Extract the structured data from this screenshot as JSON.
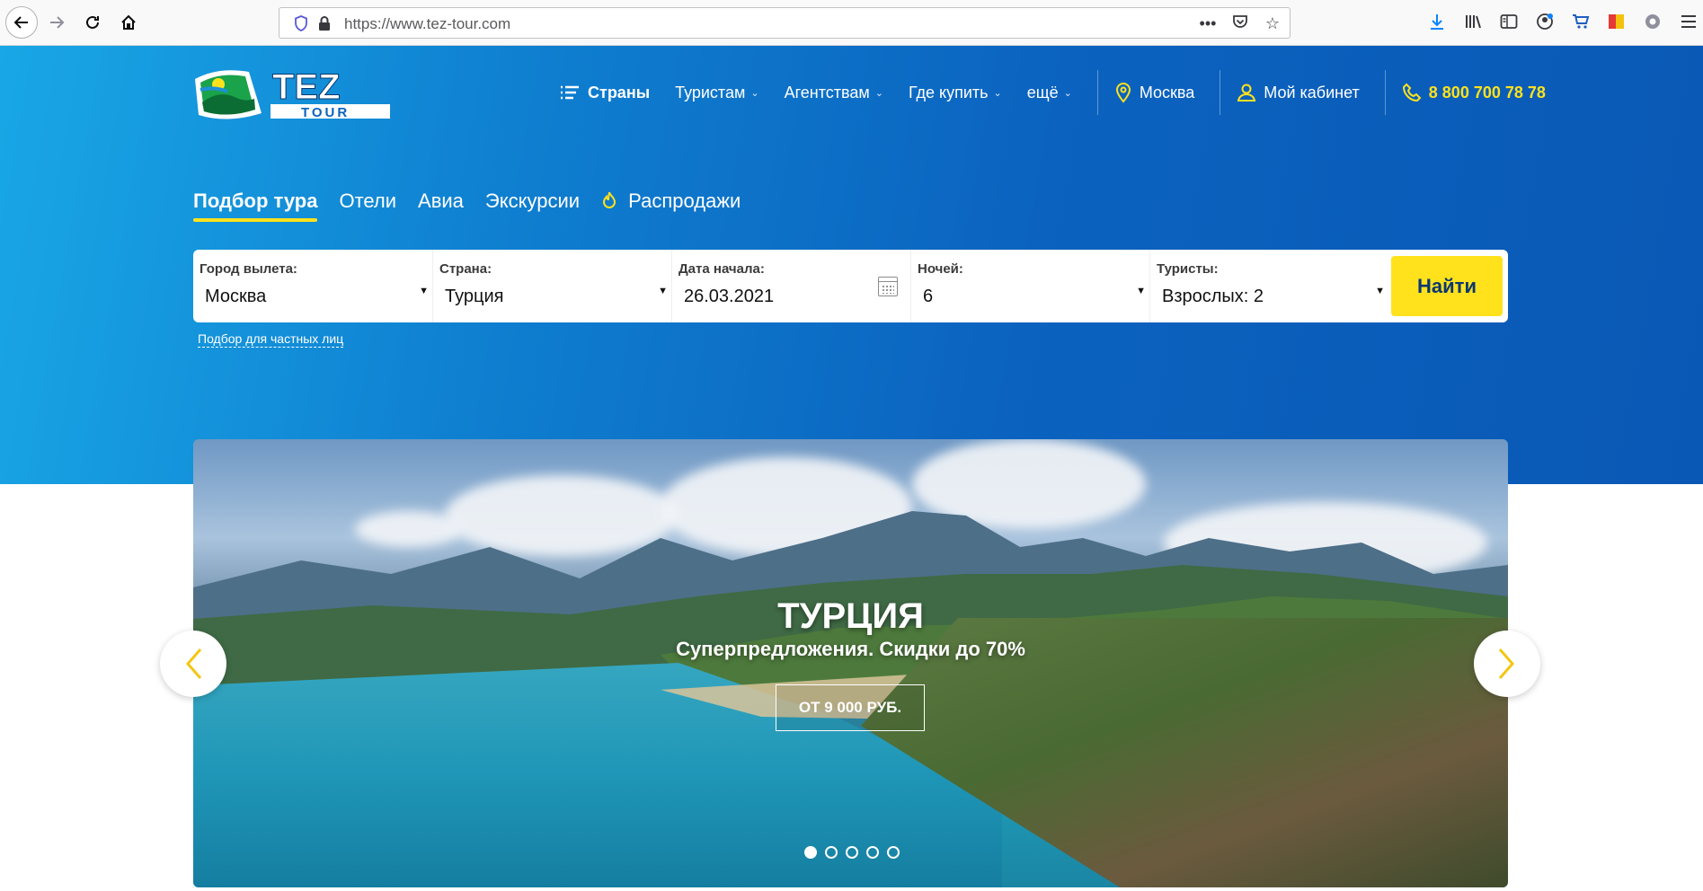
{
  "browser": {
    "url": "https://www.tez-tour.com"
  },
  "brand": {
    "logo_line1": "TEZ",
    "logo_line2": "TOUR",
    "accent": "#ffe21c",
    "primary": "#0b63bf"
  },
  "nav": {
    "countries": "Страны",
    "tourists": "Туристам",
    "agencies": "Агентствам",
    "where_buy": "Где купить",
    "more": "ещё",
    "city": "Москва",
    "cabinet": "Мой кабинет",
    "phone": "8 800 700 78 78"
  },
  "tabs": [
    {
      "label": "Подбор тура",
      "active": true
    },
    {
      "label": "Отели"
    },
    {
      "label": "Авиа"
    },
    {
      "label": "Экскурсии"
    },
    {
      "label": "Распродажи"
    }
  ],
  "search": {
    "departure_label": "Город вылета:",
    "departure_value": "Москва",
    "country_label": "Страна:",
    "country_value": "Турция",
    "date_label": "Дата начала:",
    "date_value": "26.03.2021",
    "nights_label": "Ночей:",
    "nights_value": "6",
    "tourists_label": "Туристы:",
    "tourists_value": "Взрослых: 2",
    "find_button": "Найти",
    "private_link": "Подбор для частных лиц"
  },
  "banner": {
    "title": "ТУРЦИЯ",
    "subtitle": "Суперпредложения. Скидки до 70%",
    "cta": "ОТ 9 000 РУБ.",
    "slides_total": 5,
    "active_slide": 1
  }
}
